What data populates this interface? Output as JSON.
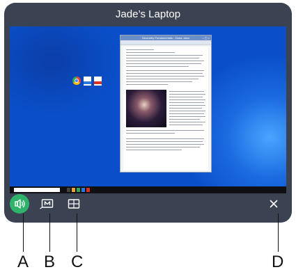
{
  "window": {
    "title": "Jade’s Laptop"
  },
  "screen": {
    "document_window": {
      "title": "Geometry Fundamentals - Class .docx"
    }
  },
  "toolbar": {
    "buttons": [
      {
        "name": "audio-button",
        "icon": "speaker-icon"
      },
      {
        "name": "mirror-button",
        "icon": "screen-m-icon"
      },
      {
        "name": "layout-button",
        "icon": "split-screen-icon"
      },
      {
        "name": "close-button",
        "icon": "close-icon"
      }
    ]
  },
  "callouts": {
    "a": "A",
    "b": "B",
    "c": "C",
    "d": "D"
  },
  "colors": {
    "panel": "#3b4352",
    "accent_green": "#2fb36b",
    "desktop_blue": "#0a4fc9"
  }
}
